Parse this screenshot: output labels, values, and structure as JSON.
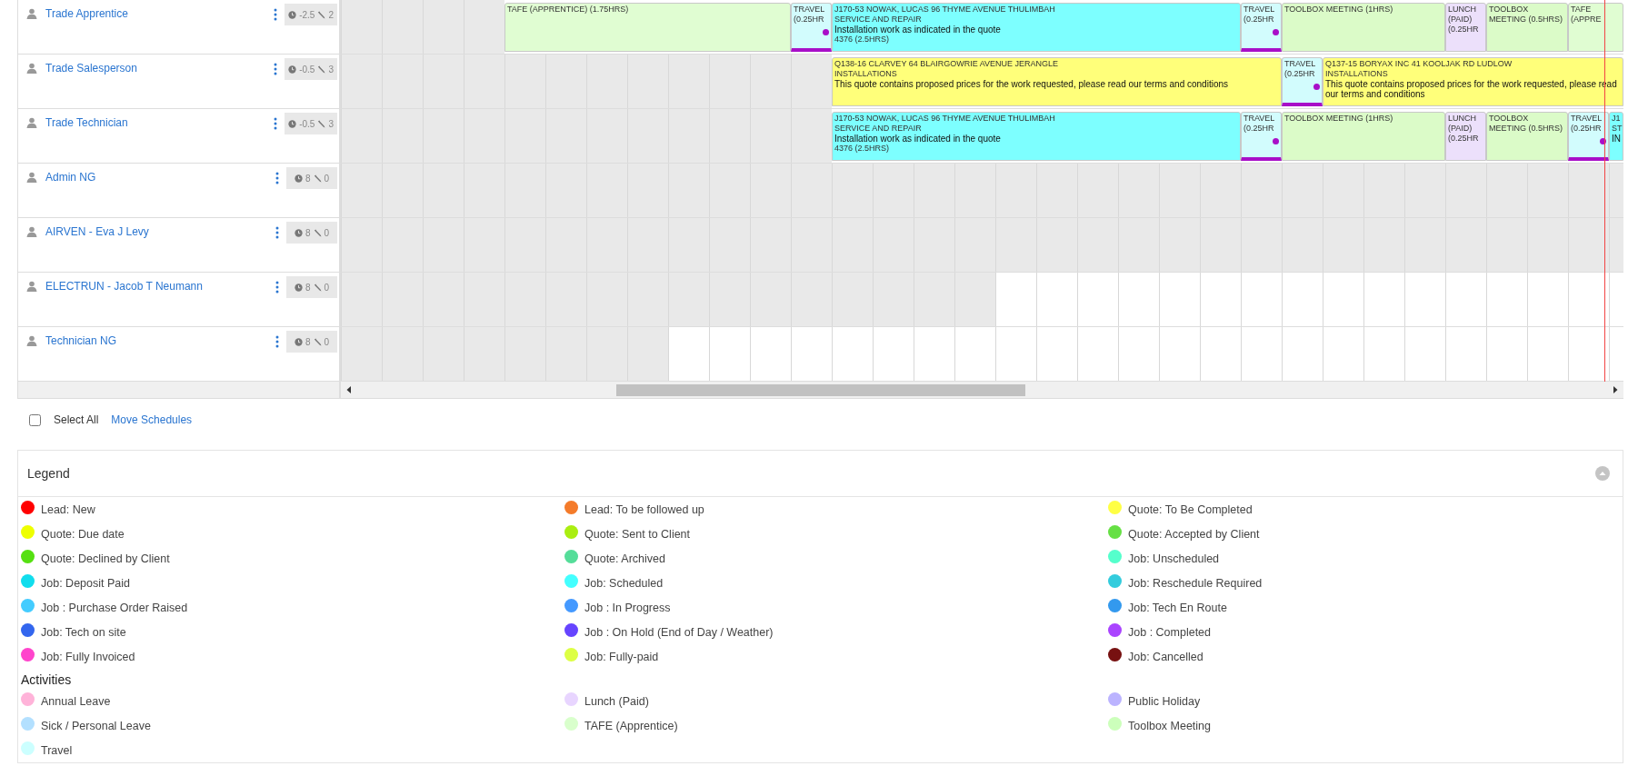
{
  "resources": [
    {
      "name": "Trade Apprentice",
      "hours": "-2.5",
      "jobs": "2",
      "events": [
        {
          "kind": "tafe",
          "title": "TAFE (APPRENTICE) (1.75HRS)"
        },
        {
          "kind": "travel",
          "title": "TRAVEL (0.25HR"
        },
        {
          "kind": "job",
          "title": "J170-53 NOWAK, LUCAS 96 THYME AVENUE THULIMBAH",
          "subtitle": "SERVICE AND REPAIR",
          "description": "Installation work as indicated in the quote",
          "footer": "4376 (2.5HRS)"
        },
        {
          "kind": "travel",
          "title": "TRAVEL (0.25HR"
        },
        {
          "kind": "toolbox",
          "title": "TOOLBOX MEETING (1HRS)"
        },
        {
          "kind": "lunch",
          "title": "LUNCH (PAID) (0.25HR"
        },
        {
          "kind": "toolbox",
          "title": "TOOLBOX MEETING (0.5HRS)"
        },
        {
          "kind": "tafe",
          "title": "TAFE (APPRE"
        }
      ]
    },
    {
      "name": "Trade Salesperson",
      "hours": "-0.5",
      "jobs": "3",
      "events": [
        {
          "kind": "quote",
          "title": "Q138-16 CLARVEY 64 BLAIRGOWRIE AVENUE JERANGLE",
          "subtitle": "INSTALLATIONS",
          "description": "This quote contains proposed prices for the work requested, please read our terms and conditions"
        },
        {
          "kind": "travel",
          "title": "TRAVEL (0.25HR"
        },
        {
          "kind": "quote",
          "title": "Q137-15 BORYAX INC 41 KOOLJAK RD LUDLOW",
          "subtitle": "INSTALLATIONS",
          "description": "This quote contains proposed prices for the work requested, please read our terms and conditions"
        }
      ]
    },
    {
      "name": "Trade Technician",
      "hours": "-0.5",
      "jobs": "3",
      "events": [
        {
          "kind": "job",
          "title": "J170-53 NOWAK, LUCAS 96 THYME AVENUE THULIMBAH",
          "subtitle": "SERVICE AND REPAIR",
          "description": "Installation work as indicated in the quote",
          "footer": "4376 (2.5HRS)"
        },
        {
          "kind": "travel",
          "title": "TRAVEL (0.25HR"
        },
        {
          "kind": "toolbox",
          "title": "TOOLBOX MEETING (1HRS)"
        },
        {
          "kind": "lunch",
          "title": "LUNCH (PAID) (0.25HR"
        },
        {
          "kind": "toolbox",
          "title": "TOOLBOX MEETING (0.5HRS)"
        },
        {
          "kind": "travel",
          "title": "TRAVEL (0.25HR"
        },
        {
          "kind": "job",
          "title": "J1",
          "subtitle": "ST",
          "description": "IN"
        }
      ]
    },
    {
      "name": "Admin NG",
      "hours": "8",
      "jobs": "0"
    },
    {
      "name": "AIRVEN - Eva J Levy",
      "hours": "8",
      "jobs": "0"
    },
    {
      "name": "ELECTRUN - Jacob T Neumann",
      "hours": "8",
      "jobs": "0"
    },
    {
      "name": "Technician NG",
      "hours": "8",
      "jobs": "0"
    }
  ],
  "select_all": {
    "label": "Select All",
    "checked": false
  },
  "move_schedules": "Move Schedules",
  "legend": {
    "title": "Legend",
    "statuses": [
      {
        "label": "Lead: New",
        "color": "#ff0000"
      },
      {
        "label": "Lead: To be followed up",
        "color": "#f47b2a"
      },
      {
        "label": "Quote: To Be Completed",
        "color": "#ffff44"
      },
      {
        "label": "Quote: Due date",
        "color": "#eeff00"
      },
      {
        "label": "Quote: Sent to Client",
        "color": "#aaee11"
      },
      {
        "label": "Quote: Accepted by Client",
        "color": "#66e044"
      },
      {
        "label": "Quote: Declined by Client",
        "color": "#55e011"
      },
      {
        "label": "Quote: Archived",
        "color": "#55dd99"
      },
      {
        "label": "Job: Unscheduled",
        "color": "#55ffcc"
      },
      {
        "label": "Job: Deposit Paid",
        "color": "#11dded"
      },
      {
        "label": "Job: Scheduled",
        "color": "#44ffff"
      },
      {
        "label": "Job: Reschedule Required",
        "color": "#33ccdd"
      },
      {
        "label": "Job : Purchase Order Raised",
        "color": "#44ccff"
      },
      {
        "label": "Job : In Progress",
        "color": "#4499ff"
      },
      {
        "label": "Job: Tech En Route",
        "color": "#3399ee"
      },
      {
        "label": "Job: Tech on site",
        "color": "#3366ee"
      },
      {
        "label": "Job : On Hold (End of Day / Weather)",
        "color": "#6644ff"
      },
      {
        "label": "Job : Completed",
        "color": "#aa44ff"
      },
      {
        "label": "Job: Fully Invoiced",
        "color": "#ff44cc"
      },
      {
        "label": "Job: Fully-paid",
        "color": "#ddff44"
      },
      {
        "label": "Job: Cancelled",
        "color": "#771111"
      }
    ],
    "activities_title": "Activities",
    "activities": [
      {
        "label": "Annual Leave",
        "color": "#ffb3d9"
      },
      {
        "label": "Lunch (Paid)",
        "color": "#e8d5ff"
      },
      {
        "label": "Public Holiday",
        "color": "#bbb3ff"
      },
      {
        "label": "Sick / Personal Leave",
        "color": "#b3e0ff"
      },
      {
        "label": "TAFE (Apprentice)",
        "color": "#d9ffcc"
      },
      {
        "label": "Toolbox Meeting",
        "color": "#ccffbb"
      },
      {
        "label": "Travel",
        "color": "#ccffff"
      }
    ]
  }
}
